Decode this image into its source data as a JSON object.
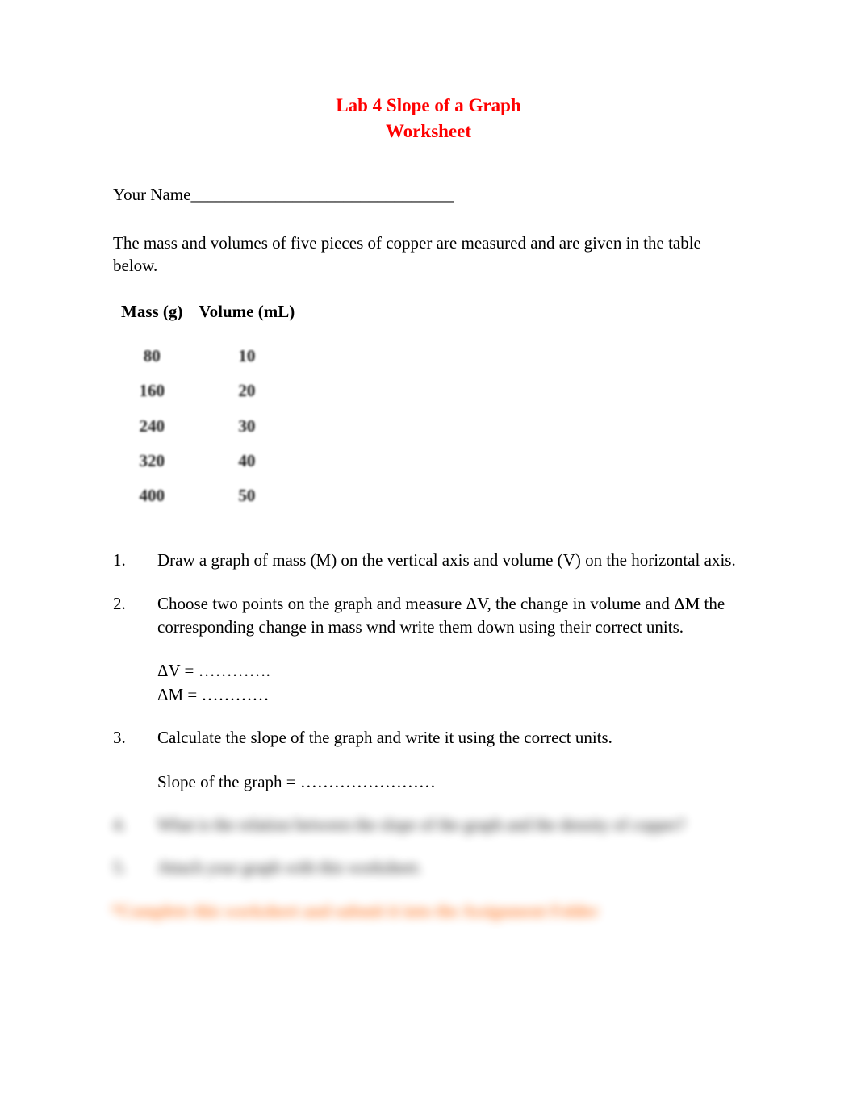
{
  "title": {
    "line1": "Lab 4 Slope of a Graph",
    "line2": "Worksheet"
  },
  "name_label": "Your Name",
  "name_blank": "_______________________________",
  "intro": "The mass and volumes of five pieces of copper are measured and are given in the table below.",
  "table": {
    "headers": [
      "Mass (g)",
      "Volume (mL)"
    ],
    "rows": [
      {
        "mass": "80",
        "volume": "10"
      },
      {
        "mass": "160",
        "volume": "20"
      },
      {
        "mass": "240",
        "volume": "30"
      },
      {
        "mass": "320",
        "volume": "40"
      },
      {
        "mass": "400",
        "volume": "50"
      }
    ]
  },
  "questions": {
    "q1": {
      "num": "1.",
      "text": "Draw a graph of mass (M) on the vertical axis and volume (V) on the horizontal axis."
    },
    "q2": {
      "num": "2.",
      "text": "Choose two points on the graph and measure ΔV, the change in volume and ΔM the corresponding change in mass wnd write them down using their correct units.",
      "dv": "ΔV = ………….",
      "dm": "ΔM = …………"
    },
    "q3": {
      "num": "3.",
      "text": "Calculate the slope of the graph and write it using the correct units.",
      "slope": "Slope of the graph = ……………………"
    },
    "q4": {
      "num": "4.",
      "text": "What is the relation between the slope of the graph and the density of copper?"
    },
    "q5": {
      "num": "5.",
      "text": "Attach your graph with this worksheet."
    }
  },
  "final_note": "*Complete this worksheet and submit it into the Assignment Folder"
}
